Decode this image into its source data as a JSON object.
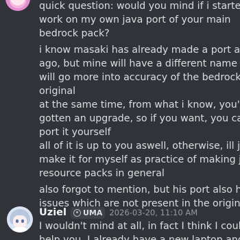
{
  "previous_message": {
    "lines": [
      "quick question: would you mind if i started",
      "work on my own java port of your main",
      "bedrock pack?",
      "i know masaki has already made a port a while",
      "ago, but mine will have a different name and",
      "will go more into accuracy of the bedrock",
      "original",
      "at the same time, from what i know, you've",
      "gotten an upgrade, so if you want, you can",
      "port it yourself",
      "all of it is up to you aswell, otherwise, ill just",
      "make it for myself as practice of making java",
      "resource packs in general",
      "also forgot to mention, but his port also has",
      "issues which are not present in the original"
    ]
  },
  "reply": {
    "username": "Uziel",
    "tag": "UMA",
    "timestamp": "2026-03-20, 11:10 AM",
    "lines": [
      "I wouldn't mind at all, in fact I think I could",
      "help you, I already have a new laptop and it"
    ]
  },
  "colors": {
    "background": "#313338",
    "text": "#dbdee1",
    "username": "#f2f3f5",
    "timestamp": "#949ba4"
  }
}
